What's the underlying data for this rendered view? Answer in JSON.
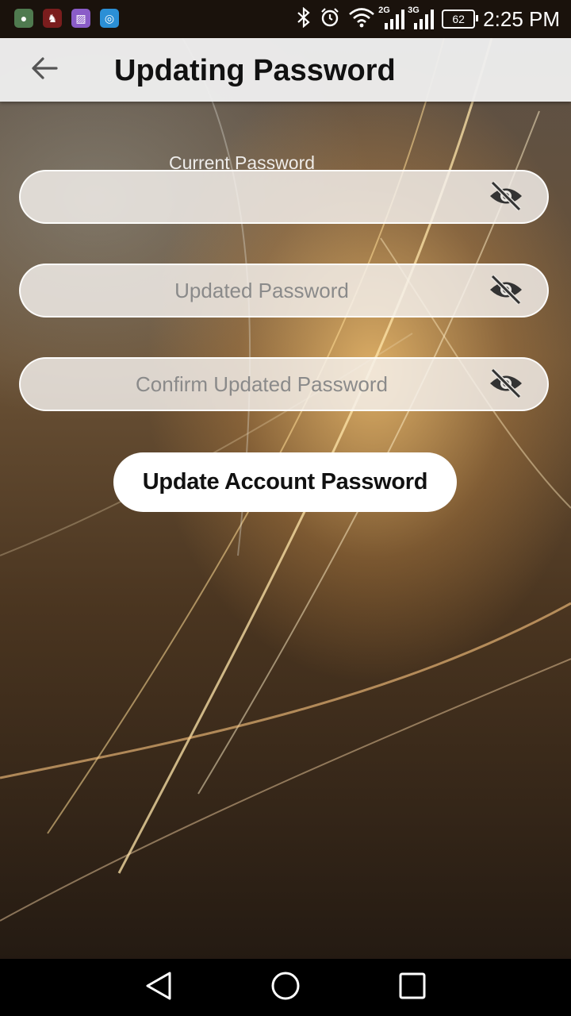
{
  "status_bar": {
    "time": "2:25 PM",
    "battery": "62",
    "network_1": "2G",
    "network_2": "3G",
    "notification_icons": [
      "gallery-app-icon",
      "game-app-icon",
      "image-app-icon",
      "vpn-app-icon"
    ],
    "system_icons": [
      "bluetooth-icon",
      "alarm-icon",
      "wifi-icon"
    ]
  },
  "app_bar": {
    "title": "Updating Password",
    "back_icon": "arrow-left-icon"
  },
  "form": {
    "current_password": {
      "label": "Current Password",
      "value": "",
      "toggle_icon": "eye-off-icon"
    },
    "updated_password": {
      "placeholder": "Updated Password",
      "value": "",
      "toggle_icon": "eye-off-icon"
    },
    "confirm_password": {
      "placeholder": "Confirm Updated Password",
      "value": "",
      "toggle_icon": "eye-off-icon"
    },
    "submit_label": "Update Account Password"
  },
  "nav_bar": {
    "icons": [
      "back-triangle-icon",
      "home-circle-icon",
      "recents-square-icon"
    ]
  },
  "colors": {
    "app_bar_bg": "#eeeeee",
    "button_bg": "#ffffff",
    "field_bg": "#f5f2ee"
  }
}
